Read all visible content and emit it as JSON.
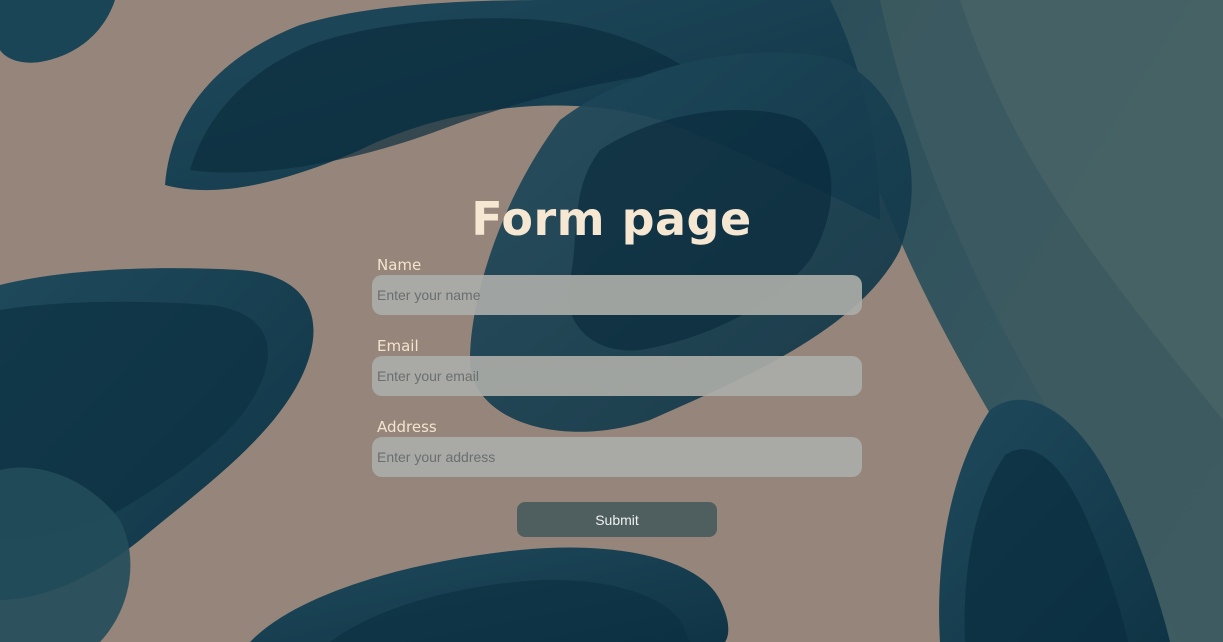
{
  "page": {
    "title": "Form page"
  },
  "form": {
    "name_label": "Name",
    "name_placeholder": "Enter your name",
    "email_label": "Email",
    "email_placeholder": "Enter your email",
    "address_label": "Address",
    "address_placeholder": "Enter your address",
    "submit_label": "Submit"
  },
  "colors": {
    "background": "#96857a",
    "title": "#f6e7d3",
    "input_background": "#aaaca8",
    "button_background": "#4f5f5f"
  }
}
